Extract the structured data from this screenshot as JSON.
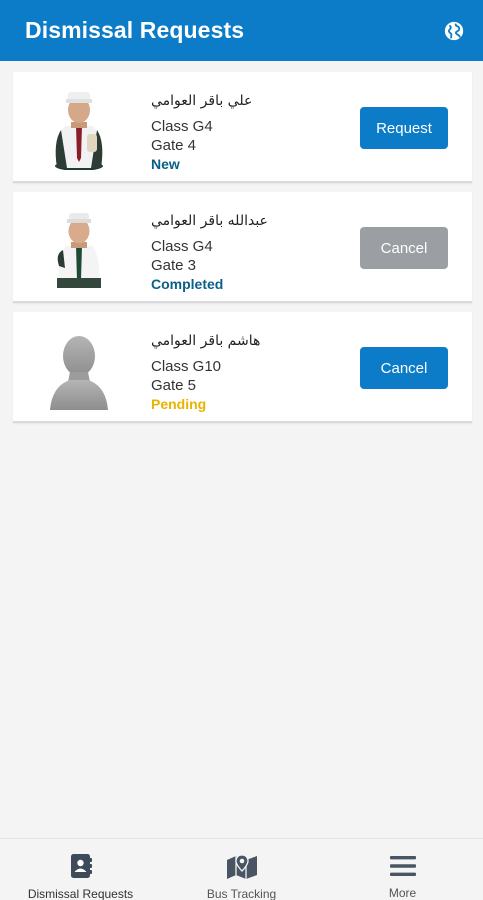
{
  "app_bar": {
    "title": "Dismissal Requests",
    "language_icon": "globe-icon"
  },
  "students": [
    {
      "name": "علي باقر العوامي",
      "class": "Class G4",
      "gate": "Gate 4",
      "status": "New",
      "status_color": "#0b5f86",
      "action_label": "Request",
      "action_color": "#0d7cc8",
      "avatar": "student-photo"
    },
    {
      "name": "عبدالله باقر العوامي",
      "class": "Class G4",
      "gate": "Gate 3",
      "status": "Completed",
      "status_color": "#0b5f86",
      "action_label": "Cancel",
      "action_color": "#9b9ea3",
      "avatar": "student-photo"
    },
    {
      "name": "هاشم باقر العوامي",
      "class": "Class G10",
      "gate": "Gate 5",
      "status": "Pending",
      "status_color": "#e8b400",
      "action_label": "Cancel",
      "action_color": "#0d7cc8",
      "avatar": "default-avatar-placeholder"
    }
  ],
  "bottom_nav": {
    "items": [
      {
        "label": "Dismissal Requests",
        "icon": "contact-book-icon"
      },
      {
        "label": "Bus Tracking",
        "icon": "map-pin-icon"
      },
      {
        "label": "More",
        "icon": "hamburger-menu-icon"
      }
    ]
  },
  "colors": {
    "primary": "#0d7cc8",
    "background": "#f4f4f4",
    "disabled": "#9b9ea3"
  }
}
